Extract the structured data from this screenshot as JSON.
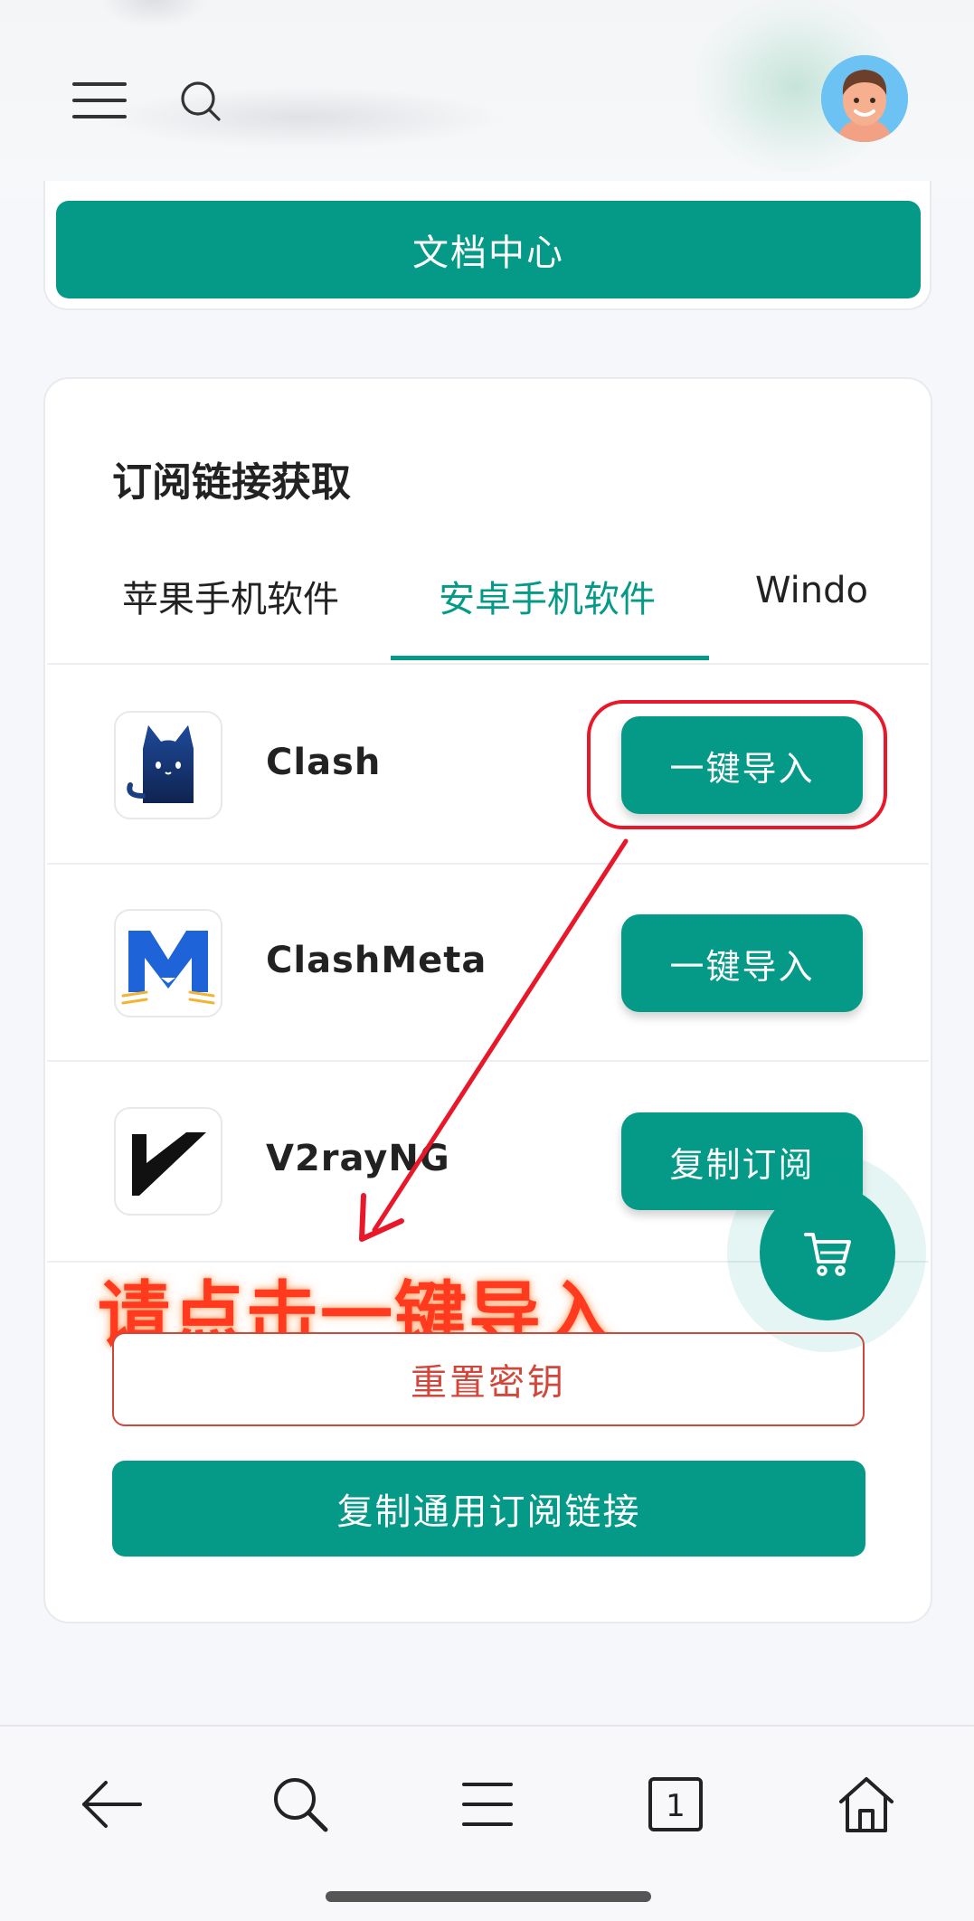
{
  "header": {
    "menu_icon": "hamburger-icon",
    "search_icon": "search-icon",
    "avatar": "memoji-avatar"
  },
  "docs": {
    "button_label": "文档中心"
  },
  "subscription": {
    "title": "订阅链接获取",
    "tabs": [
      {
        "label": "苹果手机软件",
        "active": false
      },
      {
        "label": "安卓手机软件",
        "active": true
      },
      {
        "label": "Windo",
        "active": false
      }
    ],
    "apps": [
      {
        "name": "Clash",
        "icon": "clash-cat-icon",
        "action": "一键导入"
      },
      {
        "name": "ClashMeta",
        "icon": "clashmeta-icon",
        "action": "一键导入"
      },
      {
        "name": "V2rayNG",
        "icon": "v2rayng-icon",
        "action": "复制订阅"
      }
    ],
    "reset_label": "重置密钥",
    "copy_all_label": "复制通用订阅链接"
  },
  "annotation": {
    "text": "请点击一键导入",
    "color": "#ff3a1f"
  },
  "cart": {
    "icon": "cart-icon"
  },
  "bottom_nav": [
    {
      "icon": "back-arrow-icon"
    },
    {
      "icon": "search-icon"
    },
    {
      "icon": "menu-lines-icon"
    },
    {
      "icon": "tabs-count-icon",
      "count": "1"
    },
    {
      "icon": "home-icon"
    }
  ],
  "colors": {
    "accent": "#049a87",
    "danger": "#d2473c",
    "annotation": "#ff3a1f"
  }
}
